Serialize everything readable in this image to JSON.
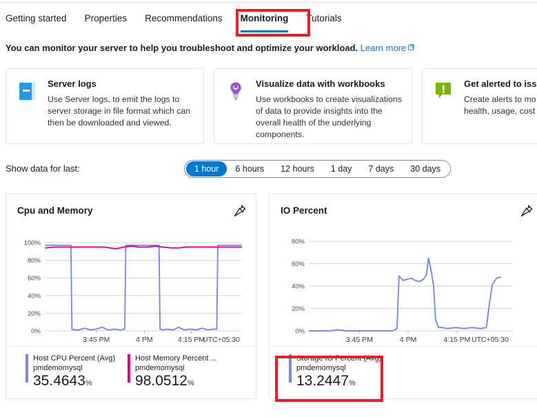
{
  "tabs": [
    {
      "label": "Getting started",
      "active": false
    },
    {
      "label": "Properties",
      "active": false
    },
    {
      "label": "Recommendations",
      "active": false
    },
    {
      "label": "Monitoring",
      "active": true
    },
    {
      "label": "Tutorials",
      "active": false
    }
  ],
  "intro": {
    "text": "You can monitor your server to help you troubleshoot and optimize your workload.",
    "link_label": "Learn more",
    "link_icon": "external-link-icon"
  },
  "cards": [
    {
      "icon": "server-logs-book-icon",
      "icon_color": "#1e9bf0",
      "title": "Server logs",
      "desc": "Use Server logs, to emit the logs to server storage in file format which can then be downloaded and viewed."
    },
    {
      "icon": "lightbulb-icon",
      "icon_color": "#9b4ddb",
      "title": "Visualize data with workbooks",
      "desc": "Use workbooks to create visualizations of data to provide insights into the overall health of the underlying components."
    },
    {
      "icon": "alert-exclamation-icon",
      "icon_color": "#7ab800",
      "title": "Get alerted to iss",
      "desc": "Create alerts to mo\nhealth, usage, cost"
    }
  ],
  "time_range": {
    "label": "Show data for last:",
    "options": [
      "1 hour",
      "6 hours",
      "12 hours",
      "1 day",
      "7 days",
      "30 days"
    ],
    "selected": "1 hour"
  },
  "accent_colors": {
    "primary_blue": "#0078d4",
    "series_blue": "#7a86e8",
    "series_magenta": "#e3008c",
    "annotation_red": "#ee1c25"
  },
  "charts": [
    {
      "title": "Cpu and Memory",
      "pin_icon": "pin-icon",
      "legend": [
        {
          "color": "#7a86e8",
          "name": "Host CPU Percent (Avg)",
          "resource": "pmdemomysql",
          "value": "35.4643",
          "unit": "%"
        },
        {
          "color": "#e3008c",
          "name": "Host Memory Percent ...",
          "resource": "pmdemomysql",
          "value": "98.0512",
          "unit": "%"
        }
      ]
    },
    {
      "title": "IO Percent",
      "pin_icon": "pin-icon",
      "legend": [
        {
          "color": "#7a86e8",
          "name": "Storage IO Percent (Avg)",
          "resource": "pmdemomysql",
          "value": "13.2447",
          "unit": "%"
        }
      ]
    }
  ],
  "chart_data": [
    {
      "type": "line",
      "title": "Cpu and Memory",
      "xlabel": "",
      "ylabel": "",
      "ylim": [
        0,
        100
      ],
      "yticks": [
        "0%",
        "20%",
        "40%",
        "60%",
        "80%",
        "100%"
      ],
      "ytick_values": [
        0,
        20,
        40,
        60,
        80,
        100
      ],
      "xticks": [
        "3:45 PM",
        "4 PM",
        "4:15 PM"
      ],
      "xtick_positions": [
        0.26,
        0.505,
        0.745
      ],
      "timezone_label": "UTC+05:30",
      "grid": true,
      "legend_position": "bottom",
      "series": [
        {
          "name": "Host CPU Percent (Avg)",
          "color": "#7a86e8",
          "display_value": 35.4643,
          "x": [
            0.0,
            0.06,
            0.11,
            0.13,
            0.135,
            0.15,
            0.17,
            0.2,
            0.23,
            0.26,
            0.29,
            0.32,
            0.35,
            0.38,
            0.405,
            0.41,
            0.43,
            0.46,
            0.5,
            0.505,
            0.53,
            0.55,
            0.58,
            0.585,
            0.6,
            0.62,
            0.65,
            0.68,
            0.71,
            0.74,
            0.77,
            0.8,
            0.83,
            0.86,
            0.875,
            0.88,
            0.9,
            0.93,
            0.96,
            1.0
          ],
          "y": [
            97,
            97,
            97,
            97,
            2,
            1,
            1,
            3,
            1,
            2,
            4,
            1,
            2,
            1,
            2,
            97,
            97,
            97,
            97,
            97,
            97,
            97,
            97,
            2,
            1,
            2,
            1,
            4,
            1,
            2,
            1,
            3,
            1,
            2,
            2,
            97,
            97,
            97,
            97,
            97
          ]
        },
        {
          "name": "Host Memory Percent (Avg)",
          "color": "#e3008c",
          "display_value": 98.0512,
          "x": [
            0.0,
            0.05,
            0.1,
            0.15,
            0.2,
            0.25,
            0.3,
            0.33,
            0.36,
            0.4,
            0.44,
            0.48,
            0.52,
            0.56,
            0.6,
            0.64,
            0.68,
            0.72,
            0.76,
            0.8,
            0.84,
            0.88,
            0.92,
            0.96,
            1.0
          ],
          "y": [
            94,
            95,
            95,
            95,
            95,
            95,
            95,
            94,
            93,
            95,
            96,
            95,
            95,
            96,
            95,
            94,
            94,
            95,
            95,
            95,
            95,
            95,
            95,
            95,
            95
          ]
        }
      ]
    },
    {
      "type": "line",
      "title": "IO Percent",
      "xlabel": "",
      "ylabel": "",
      "ylim": [
        0,
        80
      ],
      "yticks": [
        "0%",
        "20%",
        "40%",
        "60%",
        "80%"
      ],
      "ytick_values": [
        0,
        20,
        40,
        60,
        80
      ],
      "xticks": [
        "3:45 PM",
        "4 PM",
        "4:15 PM"
      ],
      "xtick_positions": [
        0.245,
        0.485,
        0.725
      ],
      "timezone_label": "UTC+05:30",
      "grid": true,
      "legend_position": "bottom",
      "series": [
        {
          "name": "Storage IO Percent (Avg)",
          "color": "#7a86e8",
          "display_value": 13.2447,
          "x": [
            0.0,
            0.05,
            0.1,
            0.14,
            0.18,
            0.24,
            0.3,
            0.36,
            0.41,
            0.43,
            0.44,
            0.46,
            0.48,
            0.5,
            0.52,
            0.54,
            0.56,
            0.575,
            0.585,
            0.6,
            0.61,
            0.62,
            0.635,
            0.65,
            0.68,
            0.72,
            0.76,
            0.8,
            0.84,
            0.87,
            0.885,
            0.9,
            0.92,
            0.94
          ],
          "y": [
            0,
            0,
            0,
            1,
            0,
            0,
            0,
            0,
            0,
            2,
            49,
            45,
            46,
            47,
            45,
            44,
            46,
            50,
            65,
            52,
            40,
            10,
            3,
            3,
            2,
            3,
            2,
            3,
            2,
            3,
            25,
            42,
            47,
            48
          ]
        }
      ]
    }
  ]
}
